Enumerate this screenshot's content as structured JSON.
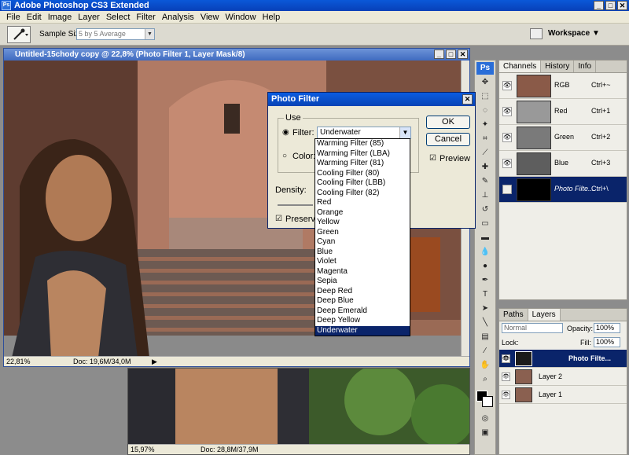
{
  "app": {
    "title": "Adobe Photoshop CS3 Extended",
    "logo": "Ps"
  },
  "menu": [
    "File",
    "Edit",
    "Image",
    "Layer",
    "Select",
    "Filter",
    "Analysis",
    "View",
    "Window",
    "Help"
  ],
  "options": {
    "sample_label": "Sample Size:",
    "sample_value": "5 by 5 Average",
    "workspace": "Workspace ▼"
  },
  "doc1": {
    "title": "Untitled-15chody copy @ 22,8% (Photo Filter 1, Layer Mask/8)",
    "zoom": "22,81%",
    "docinfo": "Doc: 19,6M/34,0M"
  },
  "doc2": {
    "zoom": "15,97%",
    "docinfo": "Doc: 28,8M/37,9M"
  },
  "dialog": {
    "title": "Photo Filter",
    "use_label": "Use",
    "filter_label": "Filter:",
    "filter_value": "Underwater",
    "color_label": "Color:",
    "density_label": "Density:",
    "preserve_label": "Preserve",
    "ok": "OK",
    "cancel": "Cancel",
    "preview": "Preview"
  },
  "filter_options": [
    "Warming Filter (85)",
    "Warming Filter (LBA)",
    "Warming Filter (81)",
    "Cooling Filter (80)",
    "Cooling Filter (LBB)",
    "Cooling Filter (82)",
    "Red",
    "Orange",
    "Yellow",
    "Green",
    "Cyan",
    "Blue",
    "Violet",
    "Magenta",
    "Sepia",
    "Deep Red",
    "Deep Blue",
    "Deep Emerald",
    "Deep Yellow",
    "Underwater"
  ],
  "channels_panel": {
    "tabs": [
      "Channels",
      "History",
      "Info"
    ],
    "rows": [
      {
        "name": "RGB",
        "key": "Ctrl+~"
      },
      {
        "name": "Red",
        "key": "Ctrl+1"
      },
      {
        "name": "Green",
        "key": "Ctrl+2"
      },
      {
        "name": "Blue",
        "key": "Ctrl+3"
      },
      {
        "name": "Photo Filte...",
        "key": "Ctrl+\\"
      }
    ]
  },
  "layers_panel": {
    "tabs": [
      "Paths",
      "Layers"
    ],
    "blend": "Normal",
    "opacity_label": "Opacity:",
    "opacity": "100%",
    "lock_label": "Lock:",
    "fill_label": "Fill:",
    "fill": "100%",
    "layers": [
      "Photo Filte...",
      "Layer 2",
      "Layer 1"
    ]
  }
}
